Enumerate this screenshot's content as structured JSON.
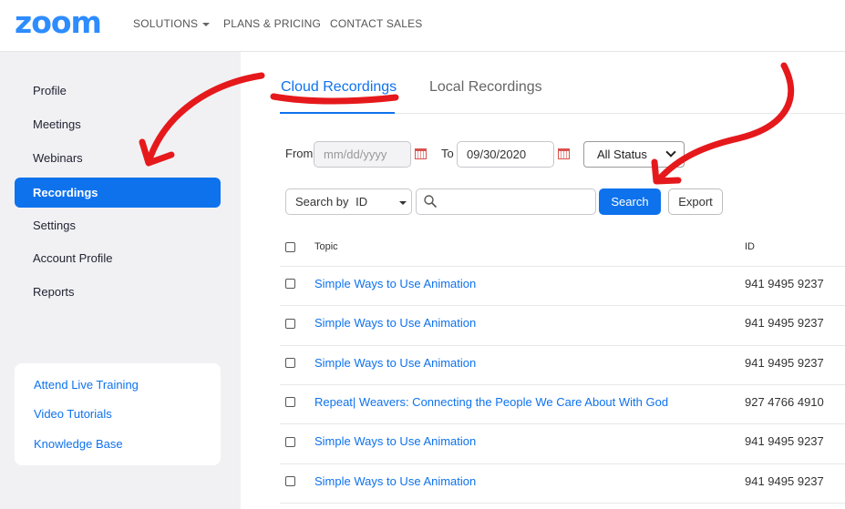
{
  "brand": {
    "logo_text": "zoom",
    "color": "#2d8cff"
  },
  "topnav": {
    "solutions": "SOLUTIONS",
    "plans": "PLANS & PRICING",
    "contact": "CONTACT SALES"
  },
  "sidebar": {
    "items": [
      {
        "label": "Profile",
        "active": false
      },
      {
        "label": "Meetings",
        "active": false
      },
      {
        "label": "Webinars",
        "active": false
      },
      {
        "label": "Recordings",
        "active": true
      },
      {
        "label": "Settings",
        "active": false
      },
      {
        "label": "Account Profile",
        "active": false
      },
      {
        "label": "Reports",
        "active": false
      }
    ],
    "links": [
      "Attend Live Training",
      "Video Tutorials",
      "Knowledge Base"
    ]
  },
  "tabs": {
    "cloud": "Cloud Recordings",
    "local": "Local Recordings",
    "active": "Cloud Recordings"
  },
  "filters": {
    "from_label": "From",
    "from_placeholder": "mm/dd/yyyy",
    "to_label": "To",
    "to_value": "09/30/2020",
    "status_value": "All Status",
    "search_by_label": "Search by",
    "search_by_value": "ID",
    "search_value": "",
    "search_button": "Search",
    "export_button": "Export"
  },
  "table": {
    "headers": {
      "topic": "Topic",
      "id": "ID"
    },
    "rows": [
      {
        "topic": "Simple Ways to Use Animation",
        "id": "941 9495 9237"
      },
      {
        "topic": "Simple Ways to Use Animation",
        "id": "941 9495 9237"
      },
      {
        "topic": "Simple Ways to Use Animation",
        "id": "941 9495 9237"
      },
      {
        "topic": "Repeat| Weavers: Connecting the People We Care About With God",
        "id": "927 4766 4910"
      },
      {
        "topic": "Simple Ways to Use Animation",
        "id": "941 9495 9237"
      },
      {
        "topic": "Simple Ways to Use Animation",
        "id": "941 9495 9237"
      }
    ]
  },
  "colors": {
    "accent": "#0e72ed",
    "annotation": "#e5191c"
  },
  "icons": [
    "search-icon",
    "calendar-icon",
    "chevron-down-icon",
    "caret-down-icon"
  ]
}
